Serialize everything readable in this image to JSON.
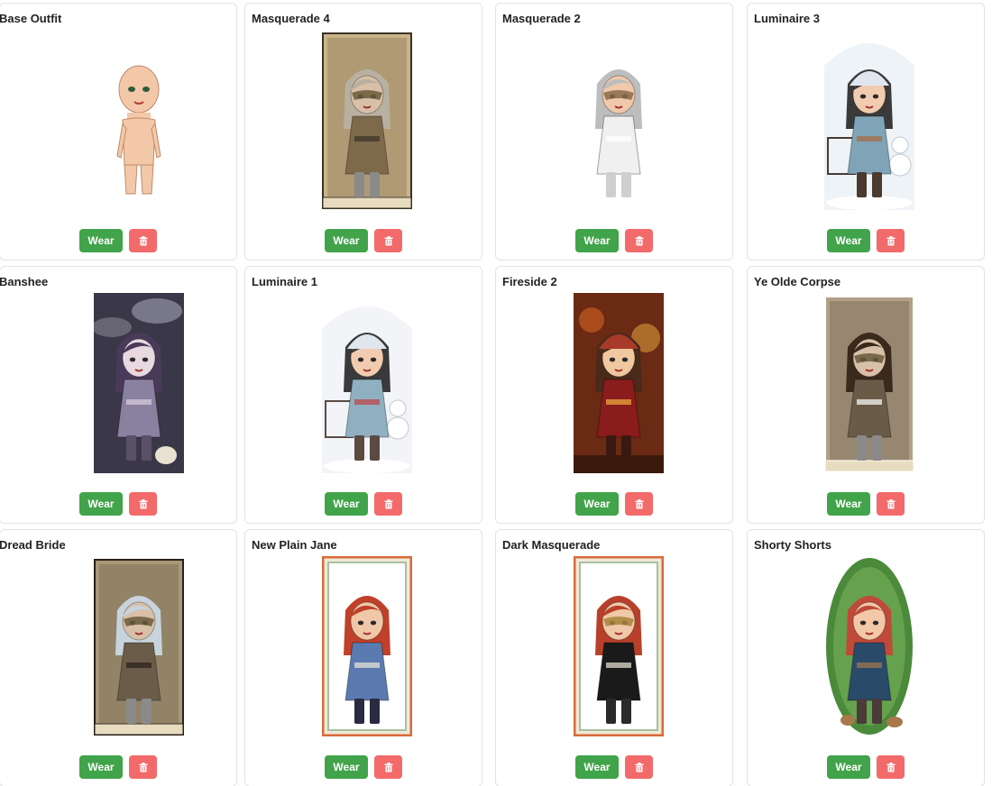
{
  "outfits": [
    {
      "name": "Base Outfit",
      "wear_label": "Wear",
      "art": "avatar-figure",
      "palette": [
        "#f5d2b8",
        "#d79a78",
        "#3c3030",
        "#ffffff"
      ]
    },
    {
      "name": "Masquerade 4",
      "wear_label": "Wear",
      "art": "framed-avatar-portrait",
      "palette": [
        "#c9b48a",
        "#7e6a4a",
        "#b8b0a0",
        "#3a3226"
      ]
    },
    {
      "name": "Masquerade 2",
      "wear_label": "Wear",
      "art": "avatar-figure",
      "palette": [
        "#e6e6e6",
        "#9a9a9a",
        "#4a4040",
        "#ffffff"
      ]
    },
    {
      "name": "Luminaire 3",
      "wear_label": "Wear",
      "art": "winter-avatar-scene",
      "palette": [
        "#eef3f8",
        "#7fa4b8",
        "#4a3a30",
        "#a86a3a"
      ]
    },
    {
      "name": "Banshee",
      "wear_label": "Wear",
      "art": "night-avatar-scene",
      "palette": [
        "#3a3848",
        "#8a80a0",
        "#2a2230",
        "#d8d0e0"
      ]
    },
    {
      "name": "Luminaire 1",
      "wear_label": "Wear",
      "art": "winter-avatar-scene",
      "palette": [
        "#f2f4f8",
        "#8fb0c0",
        "#5a4a40",
        "#c04040"
      ]
    },
    {
      "name": "Fireside 2",
      "wear_label": "Wear",
      "art": "autumn-avatar-scene",
      "palette": [
        "#6a2a14",
        "#c45a1e",
        "#8a1c1c",
        "#f0b040"
      ]
    },
    {
      "name": "Ye Olde Corpse",
      "wear_label": "Wear",
      "art": "framed-avatar-portrait",
      "palette": [
        "#b0a088",
        "#6a5a48",
        "#3a2a1c",
        "#ffffff"
      ]
    },
    {
      "name": "Dread Bride",
      "wear_label": "Wear",
      "art": "framed-avatar-portrait",
      "palette": [
        "#a89878",
        "#6a5c48",
        "#c8d4dc",
        "#2a2018"
      ]
    },
    {
      "name": "New Plain Jane",
      "wear_label": "Wear",
      "art": "bordered-avatar-card",
      "palette": [
        "#d86a3a",
        "#5a7ab0",
        "#2a2a40",
        "#f0e8d8"
      ]
    },
    {
      "name": "Dark Masquerade",
      "wear_label": "Wear",
      "art": "bordered-avatar-card",
      "palette": [
        "#d86a3a",
        "#1a1a1a",
        "#a8843a",
        "#f0e8d8"
      ]
    },
    {
      "name": "Shorty Shorts",
      "wear_label": "Wear",
      "art": "forest-avatar-scene",
      "palette": [
        "#4a8a3a",
        "#c04a3a",
        "#2a4a6a",
        "#a8784a"
      ]
    }
  ],
  "icons": {
    "delete": "trash-icon"
  },
  "colors": {
    "wear_button": "#41a34a",
    "delete_button": "#f26a6a",
    "card_border": "#e3e3e3"
  }
}
